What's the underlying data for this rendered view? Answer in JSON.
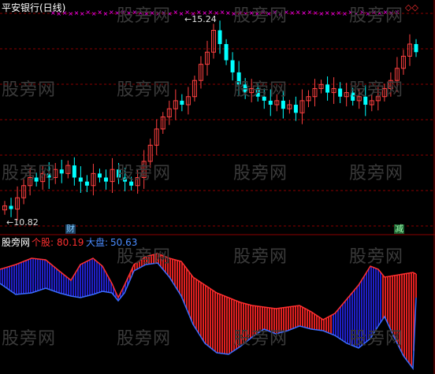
{
  "title": "平安银行(日线)",
  "upper": {
    "high_label": "15.24",
    "low_label": "10.82",
    "marker_cai": "财",
    "marker_jian": "减",
    "top_right_marker": "◇◇"
  },
  "lower": {
    "name": "股旁网",
    "stock_label": "个股:",
    "stock_value": "80.19",
    "index_label": "大盘:",
    "index_value": "50.63"
  },
  "watermark": "股旁网",
  "colors": {
    "up": "#ff4040",
    "down": "#00ffff",
    "grid": "#8b0000",
    "title": "#ffffff",
    "cross": "#ff00ff",
    "blue": "#2020c8",
    "red": "#e02020"
  },
  "chart_data": [
    {
      "type": "candlestick",
      "title": "平安银行(日线)",
      "annotations": [
        "15.24",
        "10.82",
        "财",
        "减"
      ],
      "approx_close": [
        10.9,
        10.82,
        11.1,
        11.4,
        11.6,
        11.5,
        11.7,
        11.6,
        11.8,
        11.7,
        11.9,
        11.6,
        11.5,
        11.4,
        11.7,
        11.6,
        11.5,
        11.8,
        11.6,
        11.5,
        11.4,
        11.6,
        12.0,
        12.4,
        12.8,
        13.1,
        13.3,
        13.5,
        13.4,
        13.6,
        14.0,
        14.4,
        14.7,
        15.24,
        14.9,
        14.5,
        14.2,
        13.9,
        13.7,
        13.8,
        13.6,
        13.5,
        13.4,
        13.5,
        13.3,
        13.4,
        13.2,
        13.5,
        13.6,
        13.8,
        13.9,
        13.7,
        13.8,
        13.6,
        13.7,
        13.5,
        13.6,
        13.4,
        13.5,
        13.6,
        13.8,
        14.0,
        14.3,
        14.6,
        14.9,
        14.7
      ]
    },
    {
      "type": "area",
      "series": [
        {
          "name": "个股",
          "last": 80.19
        },
        {
          "name": "大盘",
          "last": 50.63
        }
      ]
    }
  ]
}
